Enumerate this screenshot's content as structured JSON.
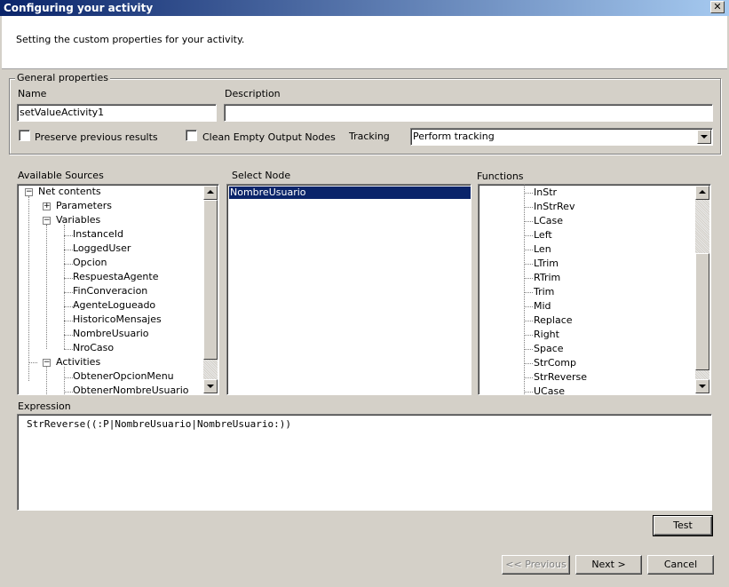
{
  "window": {
    "title": "Configuring your activity"
  },
  "header": {
    "text": "Setting the custom properties for your activity."
  },
  "general": {
    "legend": "General properties",
    "name_label": "Name",
    "name_value": "setValueActivity1",
    "description_label": "Description",
    "description_value": "",
    "preserve_label": "Preserve previous results",
    "preserve_checked": false,
    "clean_label": "Clean Empty Output Nodes",
    "clean_checked": false,
    "tracking_label": "Tracking",
    "tracking_value": "Perform tracking"
  },
  "sources": {
    "label": "Available Sources",
    "root": "Net contents",
    "parameters": "Parameters",
    "variables": "Variables",
    "variable_items": [
      "InstanceId",
      "LoggedUser",
      "Opcion",
      "RespuestaAgente",
      "FinConveracion",
      "AgenteLogueado",
      "HistoricoMensajes",
      "NombreUsuario",
      "NroCaso"
    ],
    "activities": "Activities",
    "activity_items": [
      "ObtenerOpcionMenu",
      "ObtenerNombreUsuario"
    ]
  },
  "select_node": {
    "label": "Select Node",
    "items": [
      "NombreUsuario"
    ],
    "selected_index": 0
  },
  "functions": {
    "label": "Functions",
    "items": [
      "InStr",
      "InStrRev",
      "LCase",
      "Left",
      "Len",
      "LTrim",
      "RTrim",
      "Trim",
      "Mid",
      "Replace",
      "Right",
      "Space",
      "StrComp",
      "StrReverse",
      "UCase"
    ]
  },
  "expression": {
    "label": "Expression",
    "value": "StrReverse((:P|NombreUsuario|NombreUsuario:))"
  },
  "buttons": {
    "test": "Test",
    "previous": "<< Previous",
    "next": "Next >",
    "cancel": "Cancel"
  }
}
